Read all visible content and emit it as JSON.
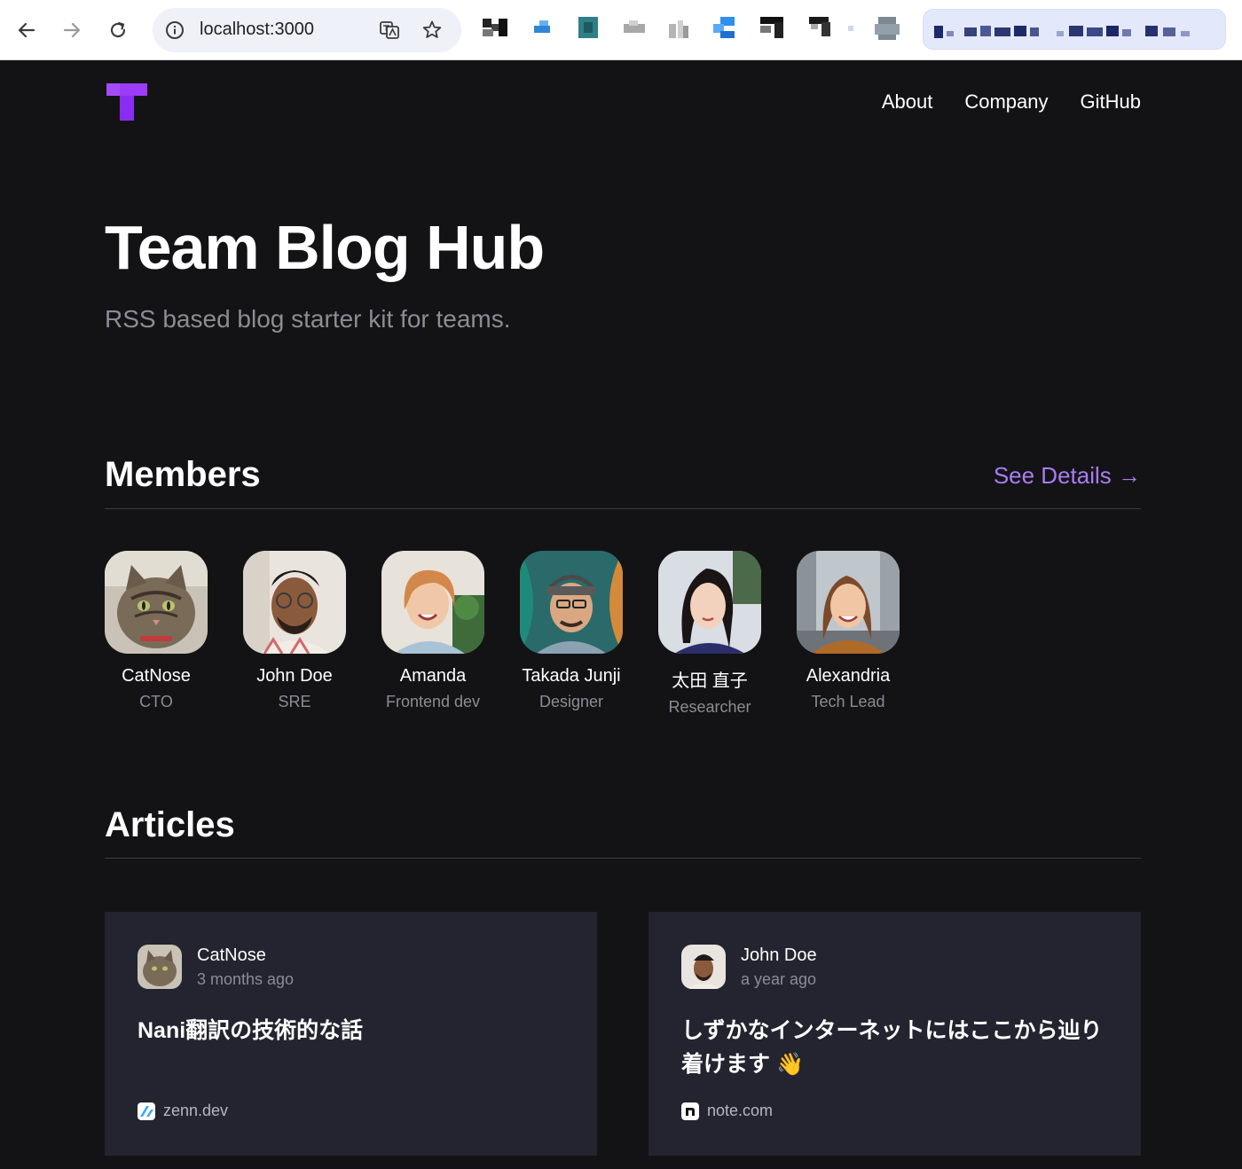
{
  "browser": {
    "url": "localhost:3000"
  },
  "site": {
    "logo_letter": "T",
    "nav": [
      {
        "label": "About"
      },
      {
        "label": "Company"
      },
      {
        "label": "GitHub"
      }
    ],
    "hero": {
      "title": "Team Blog Hub",
      "subtitle": "RSS based blog starter kit for teams."
    },
    "members_section": {
      "title": "Members",
      "link_label": "See Details →"
    },
    "members": [
      {
        "name": "CatNose",
        "role": "CTO"
      },
      {
        "name": "John Doe",
        "role": "SRE"
      },
      {
        "name": "Amanda",
        "role": "Frontend dev"
      },
      {
        "name": "Takada Junji",
        "role": "Designer"
      },
      {
        "name": "太田 直子",
        "role": "Researcher"
      },
      {
        "name": "Alexandria",
        "role": "Tech Lead"
      }
    ],
    "articles_section": {
      "title": "Articles"
    },
    "articles": [
      {
        "author": "CatNose",
        "time": "3 months ago",
        "title": "Nani翻訳の技術的な話",
        "source": "zenn.dev"
      },
      {
        "author": "John Doe",
        "time": "a year ago",
        "title": "しずかなインターネットにはここから辿り着けます 👋",
        "source": "note.com"
      }
    ]
  },
  "colors": {
    "background": "#131315",
    "card": "#232430",
    "accent": "#a97cf2",
    "logo": "#8b2cf5",
    "muted_text": "#8b8c95"
  }
}
